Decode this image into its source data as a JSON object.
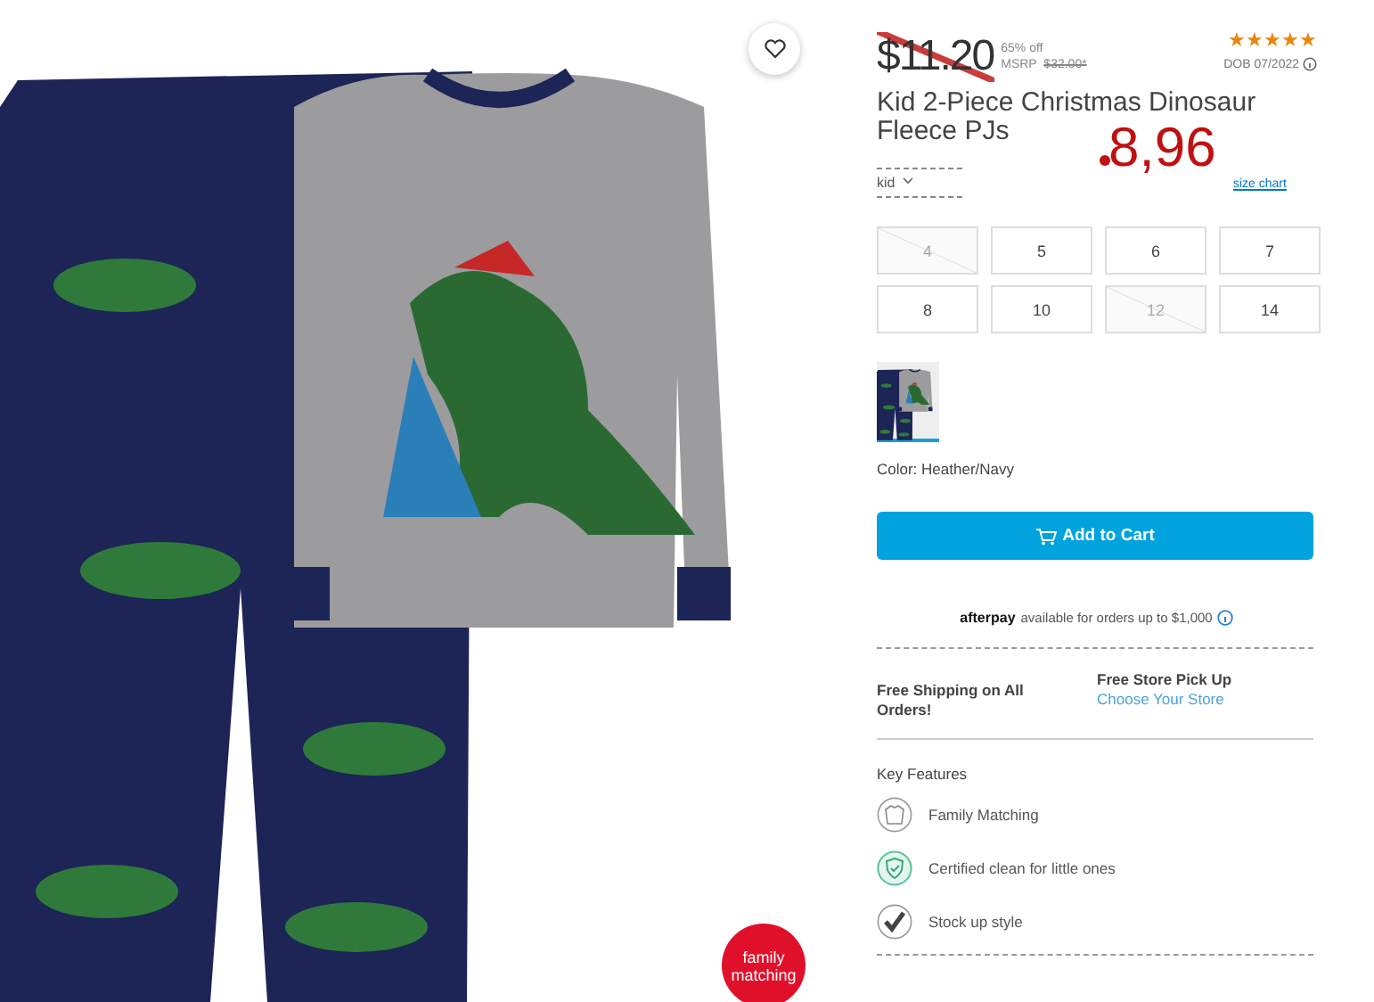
{
  "price": {
    "sale": "$11.20",
    "discount": "65% off",
    "msrp_label": "MSRP",
    "msrp": "$32.00*"
  },
  "rating": {
    "stars": 5
  },
  "dob": "DOB 07/2022",
  "title": "Kid 2-Piece Christmas Dinosaur Fleece PJs",
  "annotation": {
    "text": "8,96"
  },
  "size_selector": {
    "value": "kid"
  },
  "size_chart": "size chart",
  "sizes": [
    {
      "label": "4",
      "disabled": true
    },
    {
      "label": "5",
      "disabled": false
    },
    {
      "label": "6",
      "disabled": false
    },
    {
      "label": "7",
      "disabled": false
    },
    {
      "label": "8",
      "disabled": false
    },
    {
      "label": "10",
      "disabled": false
    },
    {
      "label": "12",
      "disabled": true
    },
    {
      "label": "14",
      "disabled": false
    }
  ],
  "swatches": [
    {
      "selected": true
    }
  ],
  "color_label": "Color: Heather/Navy",
  "add_to_cart": "Add to Cart",
  "afterpay": {
    "brand": "afterpay",
    "text": "available for orders up to $1,000"
  },
  "shipping": {
    "text": "Free Shipping on All Orders!"
  },
  "pickup": {
    "title": "Free Store Pick Up",
    "link": "Choose Your Store"
  },
  "key_features": {
    "heading": "Key Features",
    "items": [
      {
        "kind": "family",
        "label": "Family Matching"
      },
      {
        "kind": "clean",
        "label": "Certified clean for little ones"
      },
      {
        "kind": "stock",
        "label": "Stock up style"
      }
    ]
  },
  "badge": "family matching"
}
